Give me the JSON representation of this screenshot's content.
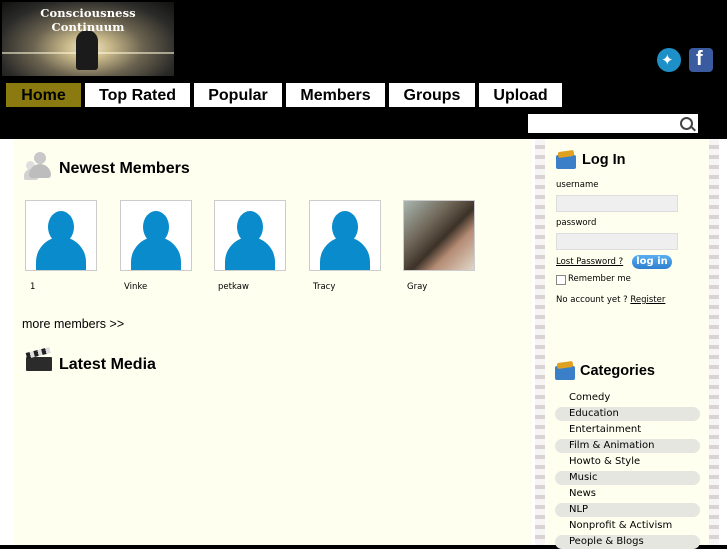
{
  "logo": {
    "title": "Consciousness Continuum"
  },
  "social": {
    "twitter": "twitter-icon",
    "facebook": "facebook-icon",
    "facebook_glyph": "f"
  },
  "nav": [
    "Home",
    "Top Rated",
    "Popular",
    "Members",
    "Groups",
    "Upload"
  ],
  "search": {
    "placeholder": ""
  },
  "newest_members": {
    "title": "Newest Members",
    "members": [
      "1",
      "Vinke",
      "petkaw",
      "Tracy",
      "Gray"
    ],
    "more_link": "more members >>"
  },
  "latest_media": {
    "title": "Latest Media"
  },
  "login": {
    "title": "Log In",
    "username_label": "username",
    "password_label": "password",
    "lost_password": "Lost Password ?",
    "button": "log in",
    "remember": "Remember me",
    "no_account": "No account yet ?",
    "register": "Register"
  },
  "categories": {
    "title": "Categories",
    "items": [
      "Comedy",
      "Education",
      "Entertainment",
      "Film & Animation",
      "Howto & Style",
      "Music",
      "News",
      "NLP",
      "Nonprofit & Activism",
      "People & Blogs"
    ]
  },
  "colors": {
    "nav_active": "#8b7a10",
    "content_bg": "#fffff0",
    "login_button": "#2d7fd0"
  }
}
